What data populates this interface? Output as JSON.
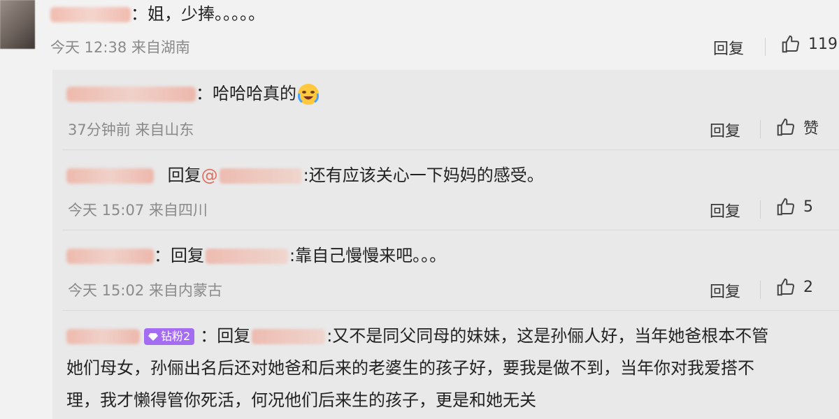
{
  "top_comment": {
    "text": "：姐，少捧。。。。。",
    "time": "今天 12:38",
    "location": "来自湖南",
    "reply_label": "回复",
    "likes": "119"
  },
  "replies": [
    {
      "sep": "：",
      "text": "哈哈哈真的",
      "time": "37分钟前",
      "location": "来自山东",
      "reply_label": "回复",
      "likes": "赞"
    },
    {
      "reply_prefix": "回复",
      "mention_text": "@",
      "text": ":还有应该关心一下妈妈的感受。",
      "time": "今天 15:07",
      "location": "来自四川",
      "reply_label": "回复",
      "likes": "5"
    },
    {
      "sep": "：",
      "reply_prefix": "回复",
      "text": ":靠自己慢慢来吧。。。",
      "time": "今天 15:02",
      "location": "来自内蒙古",
      "reply_label": "回复",
      "likes": "2"
    },
    {
      "badge": "钻粉2",
      "sep": "：",
      "reply_prefix": "回复",
      "text_line1": ":又不是同父同母的妹妹，这是孙俪人好，当年她爸根本不管",
      "text_line2": "她们母女，孙俪出名后还对她爸和后来的老婆生的孩子好，要我是做不到，当年你对我爱搭不",
      "text_line3": "理，我才懒得管你死活，何况他们后来生的孩子，更是和她无关"
    }
  ],
  "colors": {
    "background": "#f2f2f2",
    "reply_panel": "#e9e9e9",
    "meta_text": "#8a8a8a",
    "badge": "#a46cf0"
  },
  "icons": [
    "thumbs-up-icon",
    "diamond-icon",
    "crying-laughing-emoji"
  ]
}
